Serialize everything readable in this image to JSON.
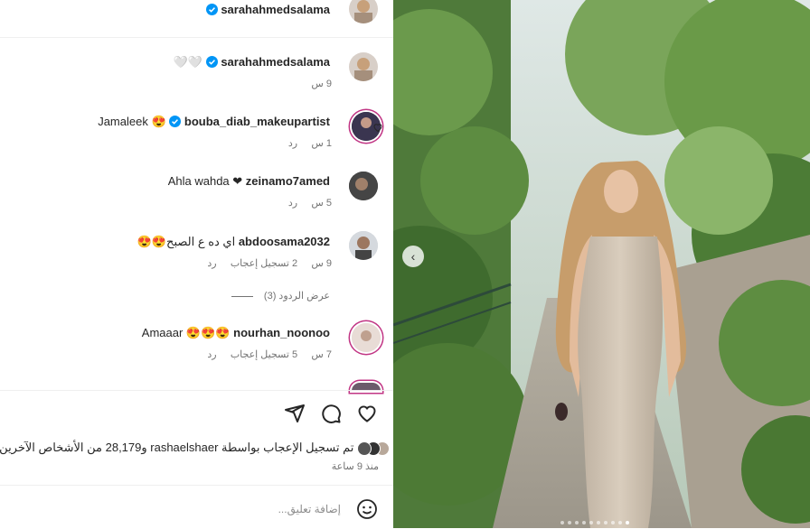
{
  "header": {
    "username": "sarahahmedsalama"
  },
  "comments": [
    {
      "username": "sarahahmedsalama",
      "text": "🤍🤍",
      "time": "9 س",
      "reply": "",
      "likes": ""
    },
    {
      "username": "bouba_diab_makeupartist",
      "text": "Jamaleek 😍",
      "time": "1 س",
      "reply": "رد",
      "likes": ""
    },
    {
      "username": "zeinamo7amed",
      "text": "Ahla wahda ❤",
      "time": "5 س",
      "reply": "رد",
      "likes": ""
    },
    {
      "username": "abdoosama2032",
      "text": "اي ده ع الصبح😍😍",
      "time": "9 س",
      "reply": "رد",
      "likes": "2 تسجيل إعجاب"
    },
    {
      "username": "nourhan_noonoo",
      "text": "Amaaar 😍😍😍",
      "time": "7 س",
      "reply": "رد",
      "likes": "5 تسجيل إعجاب"
    }
  ],
  "view_replies": "عرض الردود (3)",
  "likes_line": "تم تسجيل الإعجاب بواسطة rashaelshaer و28,179 من الأشخاص الآخرين",
  "post_time": "منذ 9 ساعة",
  "add_comment_placeholder": "إضافة تعليق...",
  "colors": {
    "verified": "#0095f6",
    "story_ring": "#c13584",
    "muted": "#737373"
  }
}
